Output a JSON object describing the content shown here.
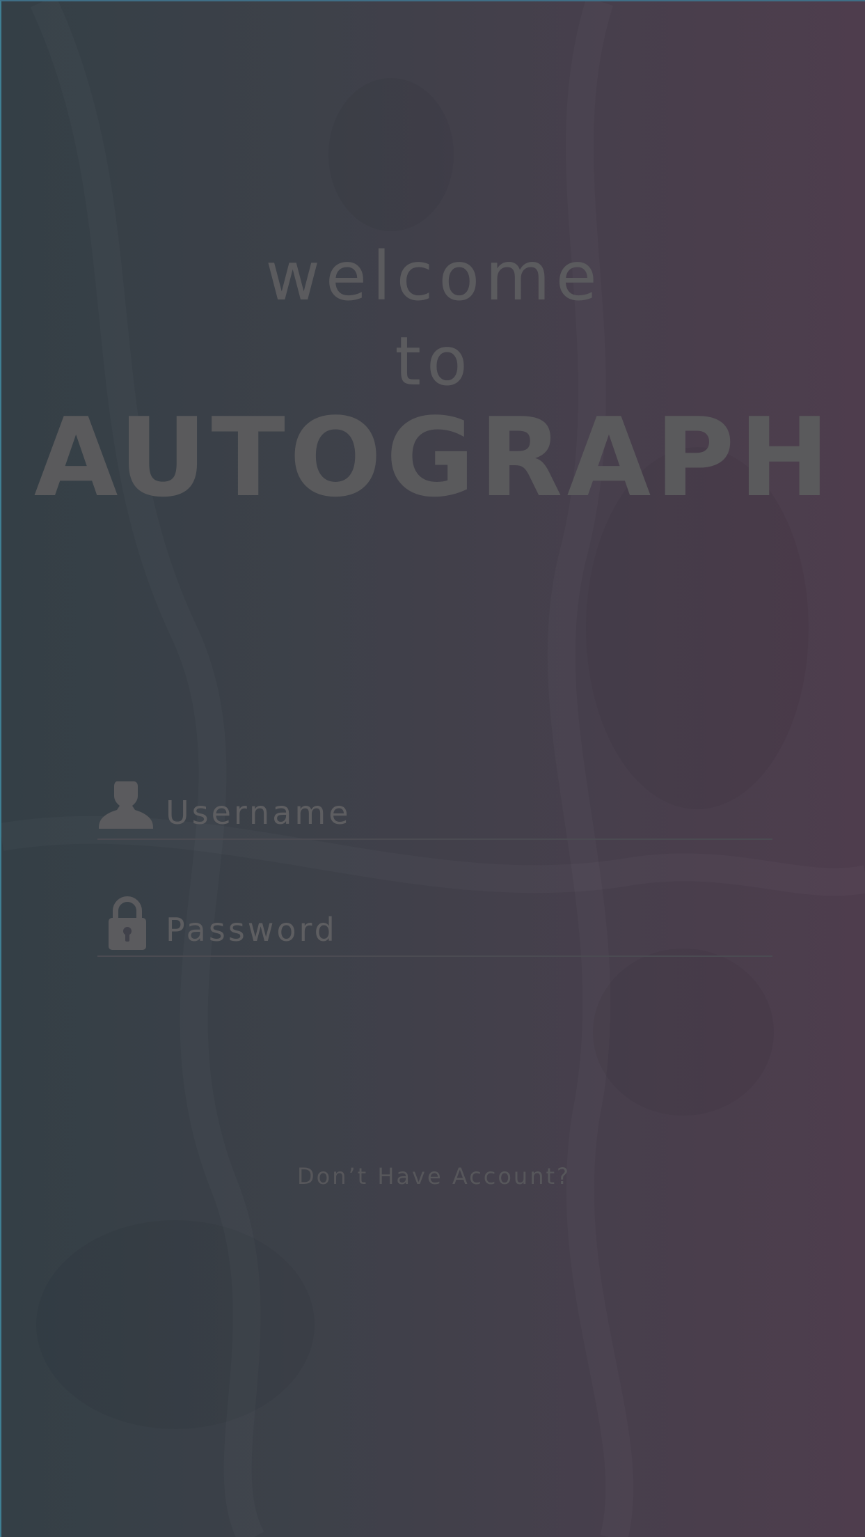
{
  "header": {
    "welcome": "welcome",
    "to": "to",
    "brand": "AUTOGRAPH"
  },
  "form": {
    "username": {
      "placeholder": "Username",
      "value": "",
      "icon": "user-icon"
    },
    "password": {
      "placeholder": "Password",
      "value": "",
      "icon": "lock-icon"
    }
  },
  "footer": {
    "signup_label": "Don’t Have Account?"
  },
  "colors": {
    "gradient_start": "#343f46",
    "gradient_end": "#4e3d4d",
    "text": "#5b5b5e"
  }
}
